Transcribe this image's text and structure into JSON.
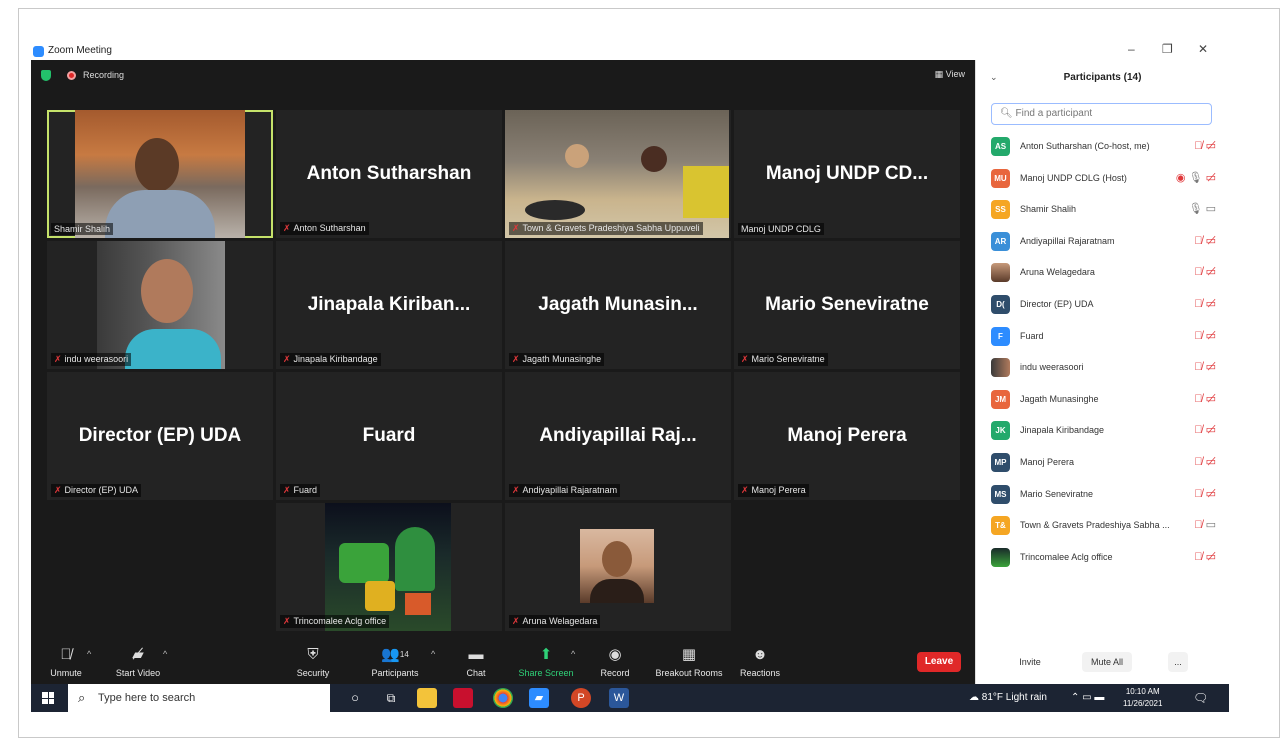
{
  "window": {
    "title": "Zoom Meeting",
    "minimize": "–",
    "maximize": "❐",
    "close": "✕"
  },
  "top": {
    "recording": "Recording",
    "view": "View"
  },
  "tiles": [
    {
      "label": "Shamir Shalih"
    },
    {
      "label": "Anton Sutharshan",
      "name": "Anton Sutharshan"
    },
    {
      "label": "Town & Gravets Pradeshiya Sabha Uppuveli"
    },
    {
      "label": "Manoj UNDP CDLG",
      "name": "Manoj UNDP CD..."
    },
    {
      "label": "indu weerasoori"
    },
    {
      "label": "Jinapala Kiribandage",
      "name": "Jinapala  Kiriban..."
    },
    {
      "label": "Jagath Munasinghe",
      "name": "Jagath  Munasin..."
    },
    {
      "label": "Mario Seneviratne",
      "name": "Mario Seneviratne"
    },
    {
      "label": "Director (EP) UDA",
      "name": "Director (EP) UDA"
    },
    {
      "label": "Fuard",
      "name": "Fuard"
    },
    {
      "label": "Andiyapillai Rajaratnam",
      "name": "Andiyapillai  Raj..."
    },
    {
      "label": "Manoj Perera",
      "name": "Manoj Perera"
    },
    {
      "label": "Trincomalee Aclg office"
    },
    {
      "label": "Aruna Welagedara"
    }
  ],
  "toolbar": {
    "unmute": "Unmute",
    "start_video": "Start Video",
    "security": "Security",
    "participants": "Participants",
    "participants_count": "14",
    "chat": "Chat",
    "share_screen": "Share Screen",
    "record": "Record",
    "breakout": "Breakout Rooms",
    "reactions": "Reactions",
    "leave": "Leave"
  },
  "panel": {
    "title": "Participants (14)",
    "search_placeholder": "Find a participant",
    "participants": [
      {
        "initials": "AS",
        "name": "Anton Sutharshan (Co-host, me)",
        "color": "#23a96b"
      },
      {
        "initials": "MU",
        "name": "Manoj UNDP CDLG (Host)",
        "color": "#e8663d"
      },
      {
        "initials": "SS",
        "name": "Shamir Shalih",
        "color": "#f5a623"
      },
      {
        "initials": "AR",
        "name": "Andiyapillai Rajaratnam",
        "color": "#3a8fd8"
      },
      {
        "initials": "",
        "name": "Aruna Welagedara",
        "color": "#8b5a3c"
      },
      {
        "initials": "D(",
        "name": "Director (EP) UDA",
        "color": "#2f4d6b"
      },
      {
        "initials": "F",
        "name": "Fuard",
        "color": "#2d8cff"
      },
      {
        "initials": "",
        "name": "indu weerasoori",
        "color": "#6a4b3a"
      },
      {
        "initials": "JM",
        "name": "Jagath Munasinghe",
        "color": "#e8663d"
      },
      {
        "initials": "JK",
        "name": "Jinapala Kiribandage",
        "color": "#23a96b"
      },
      {
        "initials": "MP",
        "name": "Manoj Perera",
        "color": "#2f4d6b"
      },
      {
        "initials": "MS",
        "name": "Mario Seneviratne",
        "color": "#2f4d6b"
      },
      {
        "initials": "T&",
        "name": "Town & Gravets Pradeshiya Sabha ...",
        "color": "#f5a623"
      },
      {
        "initials": "",
        "name": "Trincomalee Aclg office",
        "color": "#2e5a2e"
      }
    ],
    "invite": "Invite",
    "mute_all": "Mute All",
    "more": "..."
  },
  "taskbar": {
    "search_placeholder": "Type here to search",
    "weather": "81°F  Light rain",
    "time": "10:10 AM",
    "date": "11/26/2021"
  }
}
